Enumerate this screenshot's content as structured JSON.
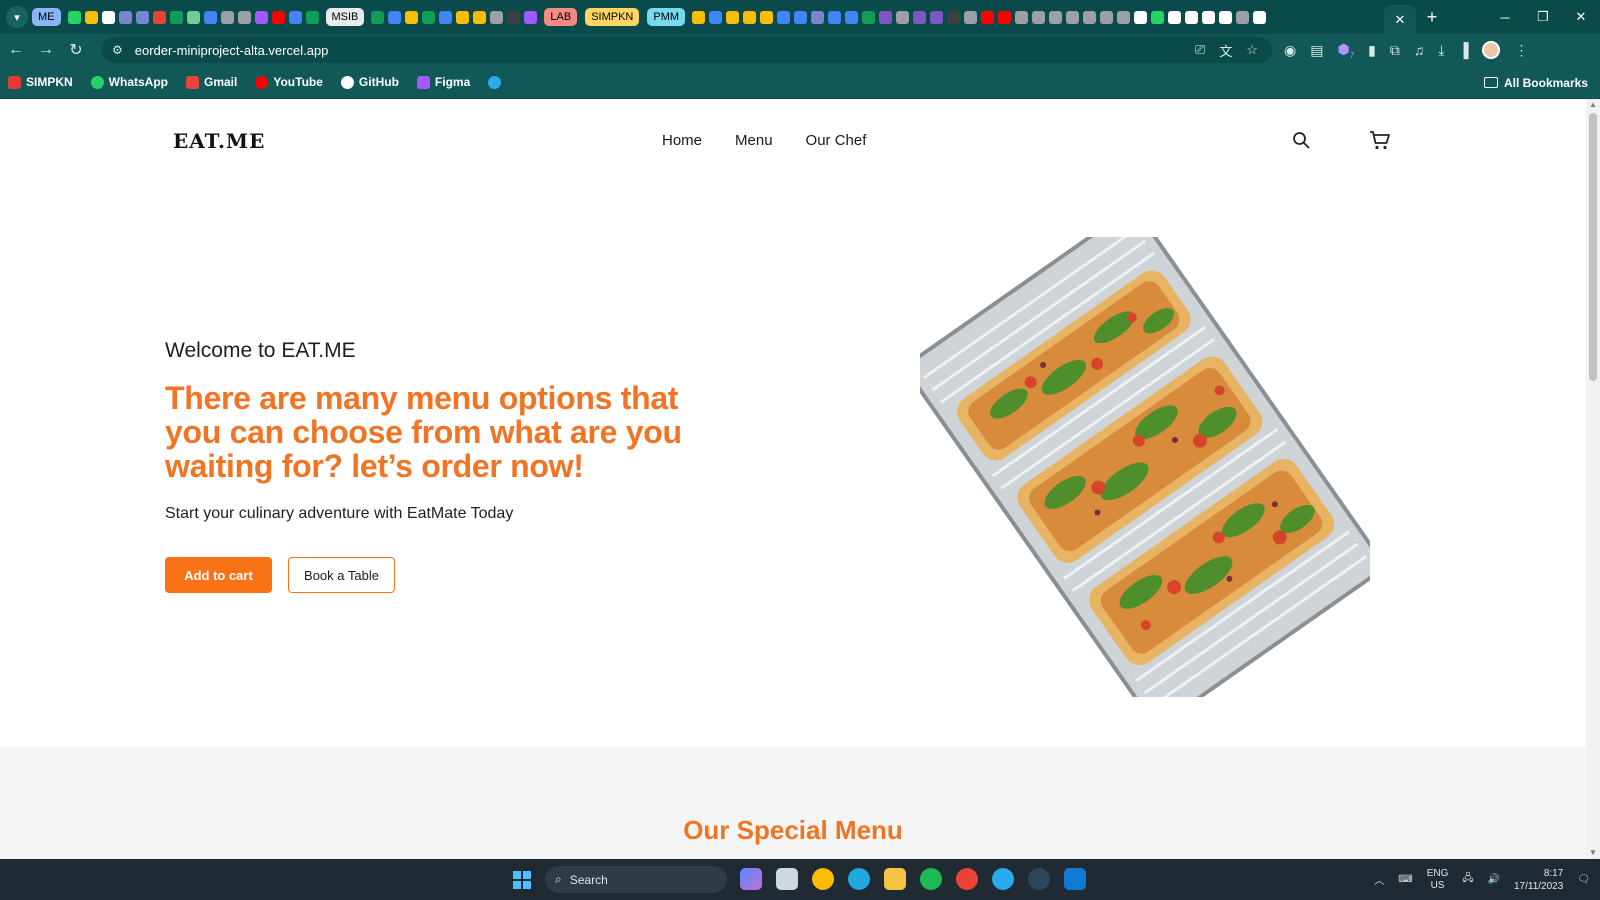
{
  "browser": {
    "tab_groups": [
      "ME",
      "MSIB",
      "LAB",
      "SIMPKN",
      "PMM"
    ],
    "group_colors": [
      "#8ab4f8",
      "#e8eaed",
      "#f28b82",
      "#fdd663",
      "#78d9ec"
    ],
    "url": "eorder-miniproject-alta.vercel.app",
    "bookmarks": [
      "SIMPKN",
      "WhatsApp",
      "Gmail",
      "YouTube",
      "GitHub",
      "Figma"
    ],
    "bookmark_colors": [
      "#e53935",
      "#25d366",
      "#ea4335",
      "#ff0000",
      "#ffffff",
      "#a259ff"
    ],
    "all_bookmarks": "All Bookmarks",
    "extension_badge": "7"
  },
  "site": {
    "logo": "EAT.ME",
    "nav": [
      "Home",
      "Menu",
      "Our Chef"
    ],
    "accent": "#f97316"
  },
  "hero": {
    "welcome": "Welcome to EAT.ME",
    "title": "There are many menu options that you can choose from what are you waiting for? let’s order now!",
    "subtitle": "Start your culinary adventure with EatMate Today",
    "btn_primary": "Add to cart",
    "btn_secondary": "Book a Table"
  },
  "special": {
    "title": "Our Special Menu"
  },
  "taskbar": {
    "search": "Search",
    "lang_line1": "ENG",
    "lang_line2": "US",
    "time": "8:17",
    "date": "17/11/2023"
  }
}
